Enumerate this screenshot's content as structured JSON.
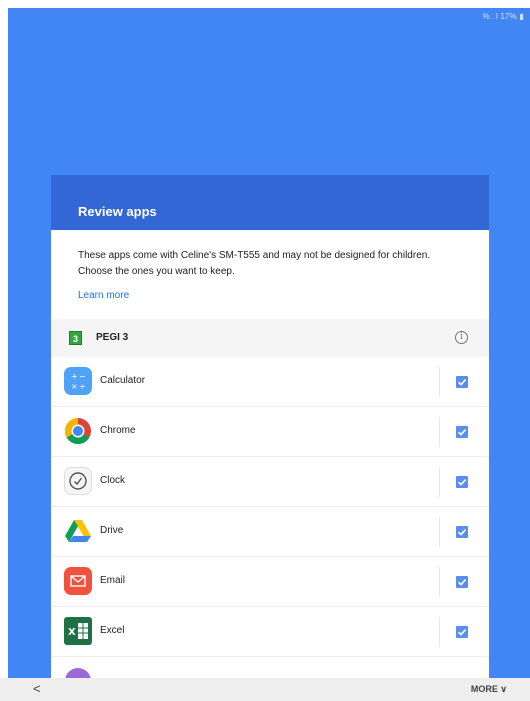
{
  "status_bar": {
    "text": "% . l 17% ▮"
  },
  "dialog": {
    "title": "Review apps",
    "description": "These apps come with Celine's SM-T555 and may not be designed for children. Choose the ones you want to keep.",
    "learn_more": "Learn more",
    "rating": {
      "badge": "3",
      "label": "PEGI 3",
      "info_icon": "info-icon"
    },
    "apps": [
      {
        "name": "Calculator",
        "icon": "calculator-icon",
        "checked": true
      },
      {
        "name": "Chrome",
        "icon": "chrome-icon",
        "checked": true
      },
      {
        "name": "Clock",
        "icon": "clock-icon",
        "checked": true
      },
      {
        "name": "Drive",
        "icon": "drive-icon",
        "checked": true
      },
      {
        "name": "Email",
        "icon": "email-icon",
        "checked": true
      },
      {
        "name": "Excel",
        "icon": "excel-icon",
        "checked": true
      }
    ]
  },
  "bottom_bar": {
    "back": "<",
    "more": "MORE ∨"
  },
  "colors": {
    "background": "#4285f4",
    "header": "#3367d6",
    "link": "#1a73e8",
    "checkbox": "#5b8dee"
  }
}
